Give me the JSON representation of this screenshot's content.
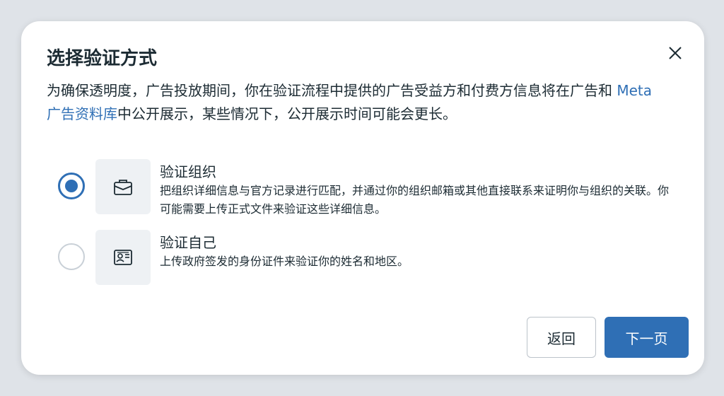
{
  "dialog": {
    "title": "选择验证方式",
    "close_icon": "close-icon",
    "description_before": "为确保透明度，广告投放期间，你在验证流程中提供的广告受益方和付费方信息将在广告和 ",
    "description_link": "Meta 广告资料库",
    "description_after": "中公开展示，某些情况下，公开展示时间可能会更长。",
    "options": [
      {
        "title": "验证组织",
        "text": "把组织详细信息与官方记录进行匹配，并通过你的组织邮箱或其他直接联系来证明你与组织的关联。你可能需要上传正式文件来验证这些详细信息。",
        "icon": "briefcase-icon",
        "selected": true
      },
      {
        "title": "验证自己",
        "text": "上传政府签发的身份证件来验证你的姓名和地区。",
        "icon": "id-card-icon",
        "selected": false
      }
    ],
    "back_label": "返回",
    "next_label": "下一页"
  },
  "colors": {
    "accent": "#2f6fb5",
    "text": "#1c2b33"
  }
}
